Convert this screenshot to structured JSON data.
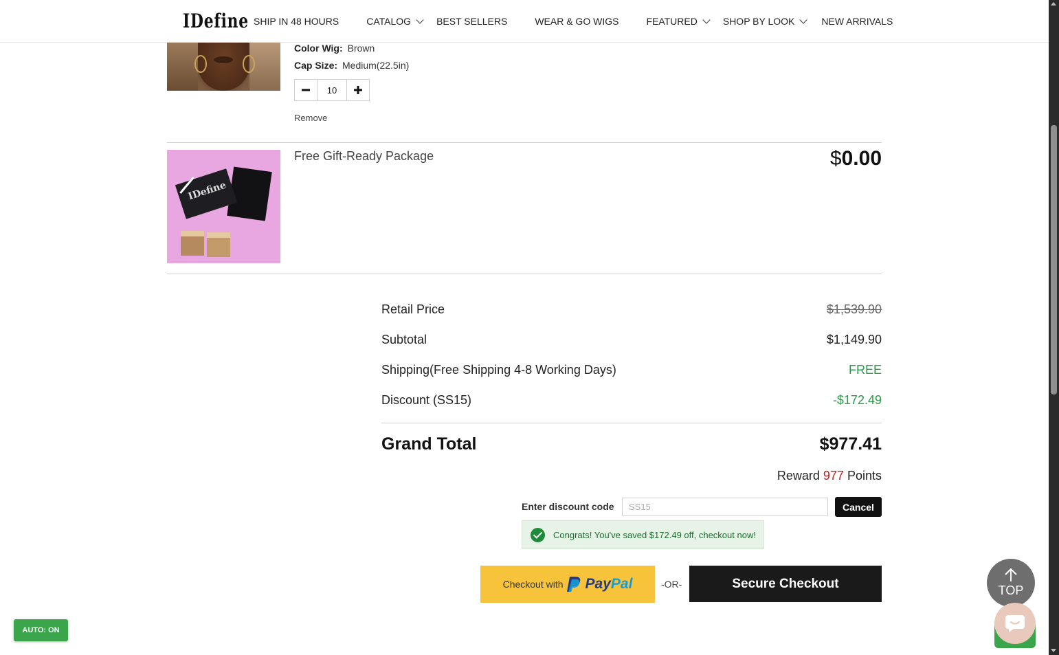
{
  "header": {
    "logo": "IDefine",
    "nav": [
      {
        "label": "SHIP IN 48 HOURS",
        "has_dropdown": false
      },
      {
        "label": "CATALOG",
        "has_dropdown": true
      },
      {
        "label": "BEST SELLERS",
        "has_dropdown": false
      },
      {
        "label": "WEAR & GO WIGS",
        "has_dropdown": false
      },
      {
        "label": "FEATURED",
        "has_dropdown": true
      },
      {
        "label": "SHOP BY LOOK",
        "has_dropdown": true
      },
      {
        "label": "NEW ARRIVALS",
        "has_dropdown": false
      }
    ]
  },
  "cart_item": {
    "color_label": "Color Wig:",
    "color_value": "Brown",
    "cap_label": "Cap Size:",
    "cap_value": "Medium(22.5in)",
    "quantity": "10",
    "remove_label": "Remove",
    "minus_icon": "minus-icon",
    "plus_icon": "plus-icon"
  },
  "gift": {
    "title": "Free Gift-Ready Package",
    "price_currency": "$",
    "price_amount": "0.00",
    "box_text": "IDefine"
  },
  "summary": {
    "retail_label": "Retail Price",
    "retail_value": "$1,539.90",
    "subtotal_label": "Subtotal",
    "subtotal_value": "$1,149.90",
    "shipping_label": "Shipping(Free Shipping 4-8 Working Days)",
    "shipping_value": "FREE",
    "discount_label": "Discount (SS15)",
    "discount_value": "-$172.49",
    "grand_label": "Grand Total",
    "grand_value": "$977.41",
    "reward_prefix": "Reward",
    "reward_points": "977",
    "reward_suffix": "Points"
  },
  "discount": {
    "label": "Enter discount code",
    "placeholder": "SS15",
    "cancel_label": "Cancel",
    "success_message": "Congrats! You've saved $172.49 off, checkout now!"
  },
  "checkout": {
    "paypal_prefix": "Checkout with",
    "paypal_word_1": "Pay",
    "paypal_word_2": "Pal",
    "or_label": "-OR-",
    "secure_label": "Secure Checkout"
  },
  "floating": {
    "auto_label": "AUTO: ON",
    "top_label": "TOP"
  },
  "colors": {
    "accent_green": "#2a9a48",
    "paypal_yellow": "#f7c33b",
    "button_dark": "#1a1a1a",
    "reward_red": "#b42525"
  }
}
